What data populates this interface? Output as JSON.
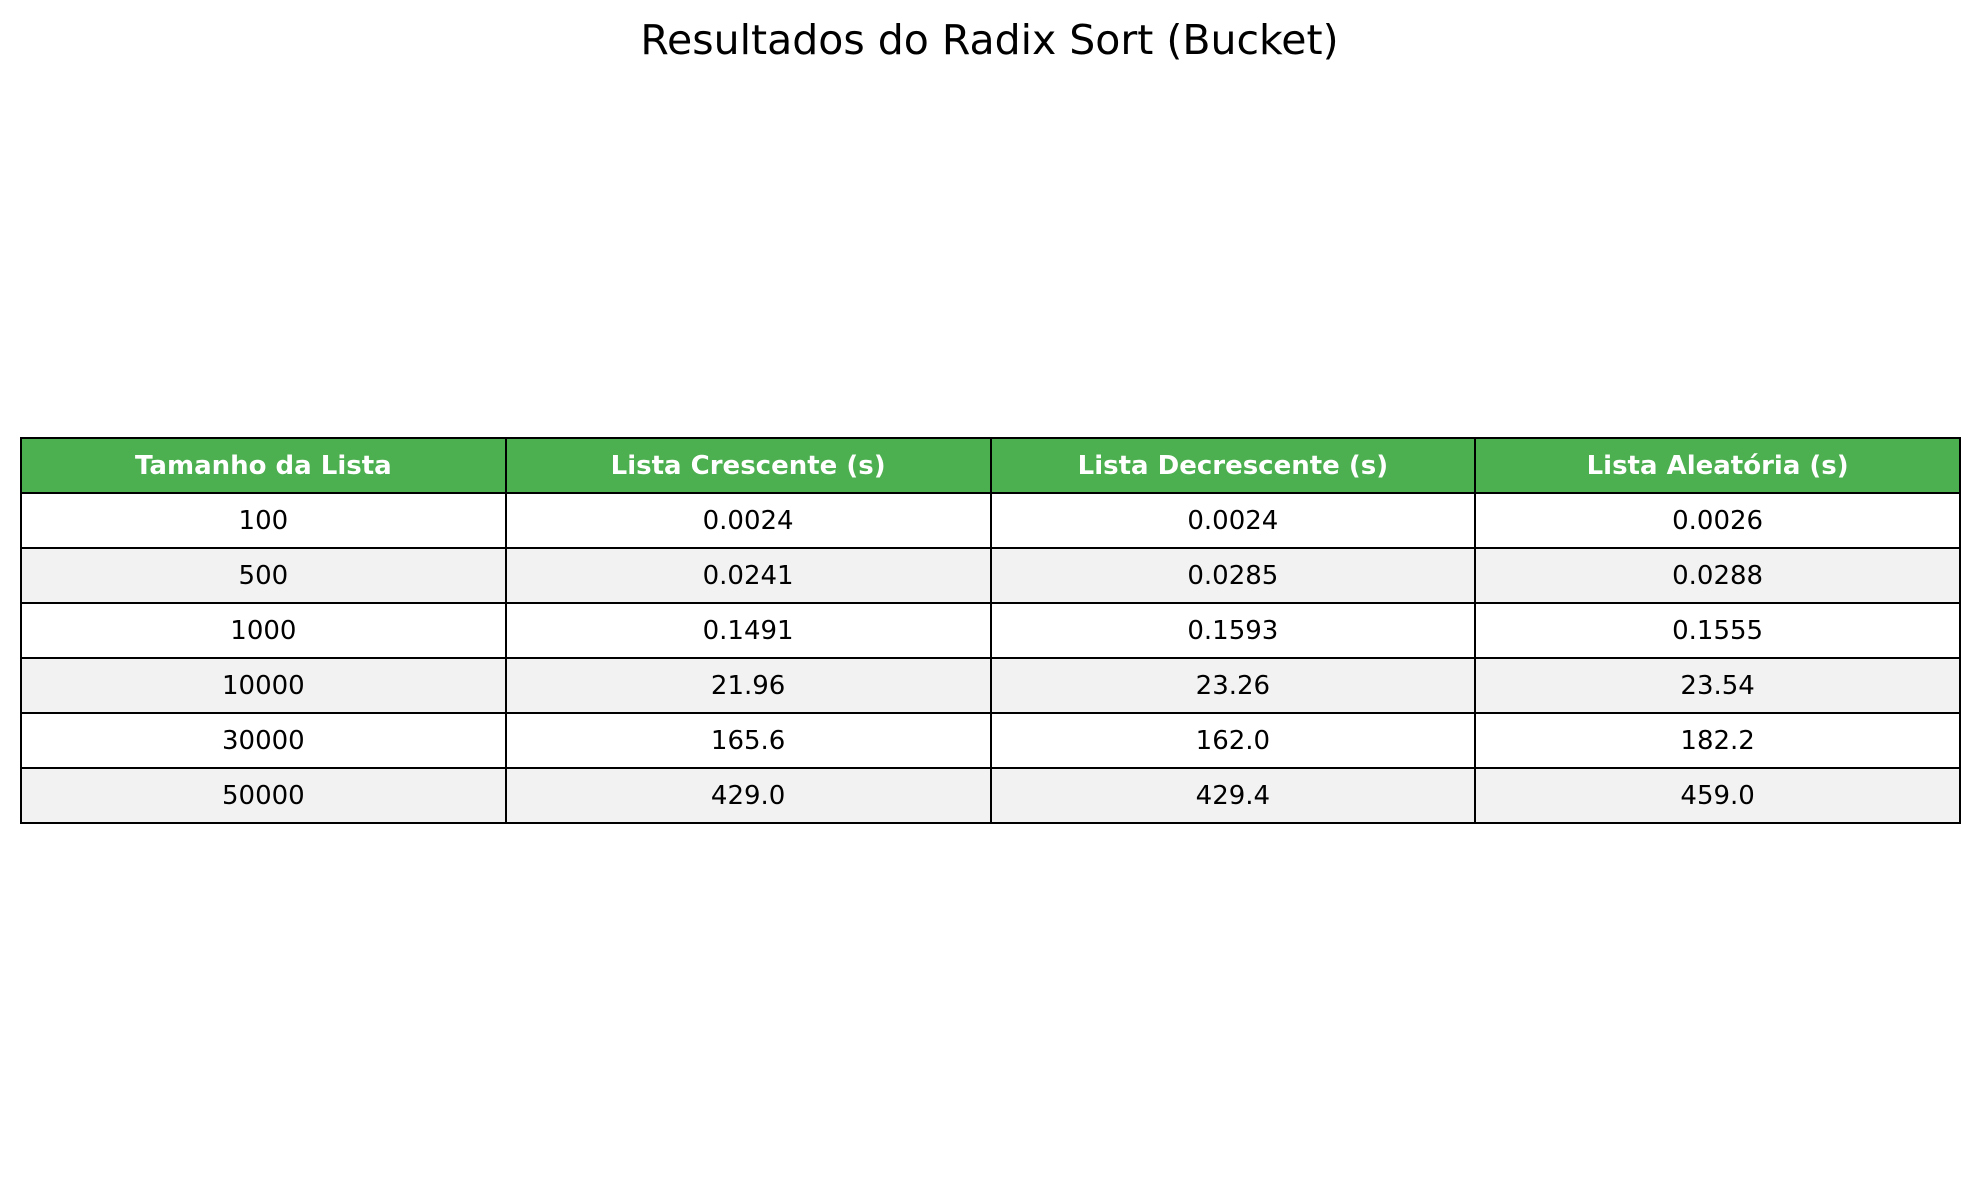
{
  "chart_data": {
    "type": "table",
    "title": "Resultados do Radix Sort (Bucket)",
    "header_color": "#4caf50",
    "stripe_color": "#f2f2f2",
    "columns": [
      "Tamanho da Lista",
      "Lista Crescente (s)",
      "Lista Decrescente (s)",
      "Lista Aleatória (s)"
    ],
    "rows": [
      [
        "100",
        "0.0024",
        "0.0024",
        "0.0026"
      ],
      [
        "500",
        "0.0241",
        "0.0285",
        "0.0288"
      ],
      [
        "1000",
        "0.1491",
        "0.1593",
        "0.1555"
      ],
      [
        "10000",
        "21.96",
        "23.26",
        "23.54"
      ],
      [
        "30000",
        "165.6",
        "162.0",
        "182.2"
      ],
      [
        "50000",
        "429.0",
        "429.4",
        "459.0"
      ]
    ]
  }
}
